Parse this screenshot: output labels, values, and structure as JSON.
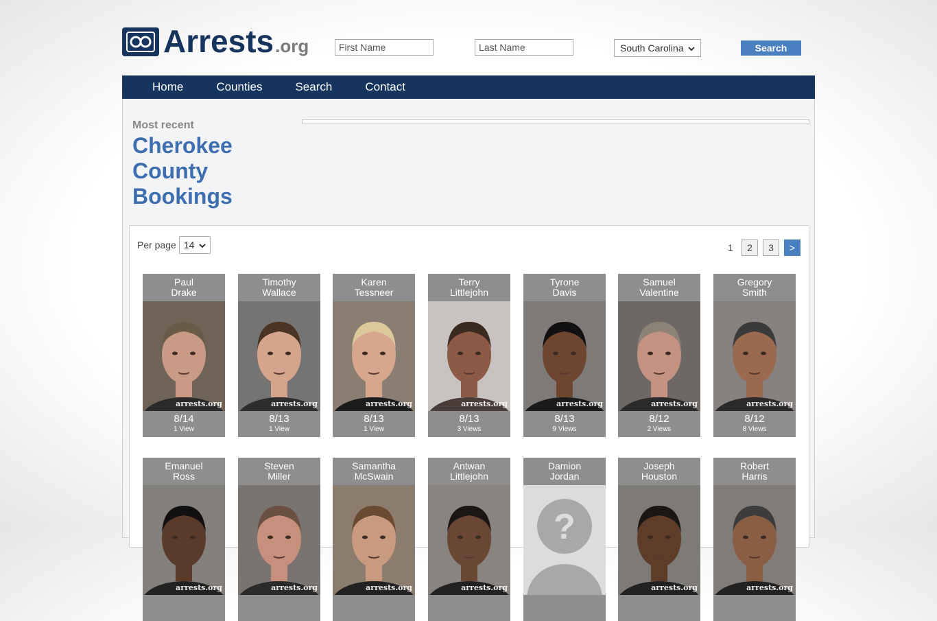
{
  "header": {
    "logo_main": "Arrests",
    "logo_org": ".org",
    "first_name_placeholder": "First Name",
    "last_name_placeholder": "Last Name",
    "state_selected": "South Carolina",
    "search_label": "Search"
  },
  "nav": [
    "Home",
    "Counties",
    "Search",
    "Contact"
  ],
  "content": {
    "most_recent": "Most recent",
    "title": "Cherokee County Bookings",
    "per_page_label": "Per page",
    "per_page_value": "14",
    "pages": [
      "1",
      "2",
      "3",
      ">"
    ]
  },
  "arrests": [
    {
      "first": "Paul",
      "last": "Drake",
      "date": "8/14",
      "views": "1 View",
      "bg": "#6f6355",
      "skin": "#c99a86",
      "hair": "#6a5a48",
      "shirt": "#2a2a2a"
    },
    {
      "first": "Timothy",
      "last": "Wallace",
      "date": "8/13",
      "views": "1 View",
      "bg": "#767473",
      "skin": "#d5a48c",
      "hair": "#4a3424",
      "shirt": "#2d2d2d"
    },
    {
      "first": "Karen",
      "last": "Tessneer",
      "date": "8/13",
      "views": "1 View",
      "bg": "#8a7e72",
      "skin": "#d6a68e",
      "hair": "#dcc89a",
      "shirt": "#1c1c1c"
    },
    {
      "first": "Terry",
      "last": "Littlejohn",
      "date": "8/13",
      "views": "3 Views",
      "bg": "#c8c3c0",
      "skin": "#8a5a44",
      "hair": "#3a2a20",
      "shirt": "#4a3c38"
    },
    {
      "first": "Tyrone",
      "last": "Davis",
      "date": "8/13",
      "views": "9 Views",
      "bg": "#7d7a78",
      "skin": "#6e4630",
      "hair": "#121010",
      "shirt": "#1a1a1a"
    },
    {
      "first": "Samuel",
      "last": "Valentine",
      "date": "8/12",
      "views": "2 Views",
      "bg": "#6d6864",
      "skin": "#c49280",
      "hair": "#8c8276",
      "shirt": "#2a2a2a"
    },
    {
      "first": "Gregory",
      "last": "Smith",
      "date": "8/12",
      "views": "8 Views",
      "bg": "#878280",
      "skin": "#9a6a50",
      "hair": "#3a3a3a",
      "shirt": "#2a2a2a"
    },
    {
      "first": "Emanuel",
      "last": "Ross",
      "date": "",
      "views": "",
      "bg": "#84807c",
      "skin": "#5a3a28",
      "hair": "#121010",
      "shirt": "#222"
    },
    {
      "first": "Steven",
      "last": "Miller",
      "date": "",
      "views": "",
      "bg": "#7a7470",
      "skin": "#c6907c",
      "hair": "#6a5040",
      "shirt": "#2a2a2a"
    },
    {
      "first": "Samantha",
      "last": "McSwain",
      "date": "",
      "views": "",
      "bg": "#8c7c6e",
      "skin": "#c89a80",
      "hair": "#6b4a32",
      "shirt": "#222"
    },
    {
      "first": "Antwan",
      "last": "Littlejohn",
      "date": "",
      "views": "",
      "bg": "#8a8480",
      "skin": "#6a4634",
      "hair": "#1a1614",
      "shirt": "#222"
    },
    {
      "first": "Damion",
      "last": "Jordan",
      "date": "",
      "views": "",
      "bg": "#dcdcdc",
      "skin": "#a8a8a8",
      "hair": "#a8a8a8",
      "shirt": "#a8a8a8",
      "placeholder": "?"
    },
    {
      "first": "Joseph",
      "last": "Houston",
      "date": "",
      "views": "",
      "bg": "#7e7a76",
      "skin": "#5e3c2a",
      "hair": "#1a1614",
      "shirt": "#222"
    },
    {
      "first": "Robert",
      "last": "Harris",
      "date": "",
      "views": "",
      "bg": "#827c78",
      "skin": "#8a5e44",
      "hair": "#3c3c3c",
      "shirt": "#222"
    }
  ],
  "watermark": "arrests.org"
}
